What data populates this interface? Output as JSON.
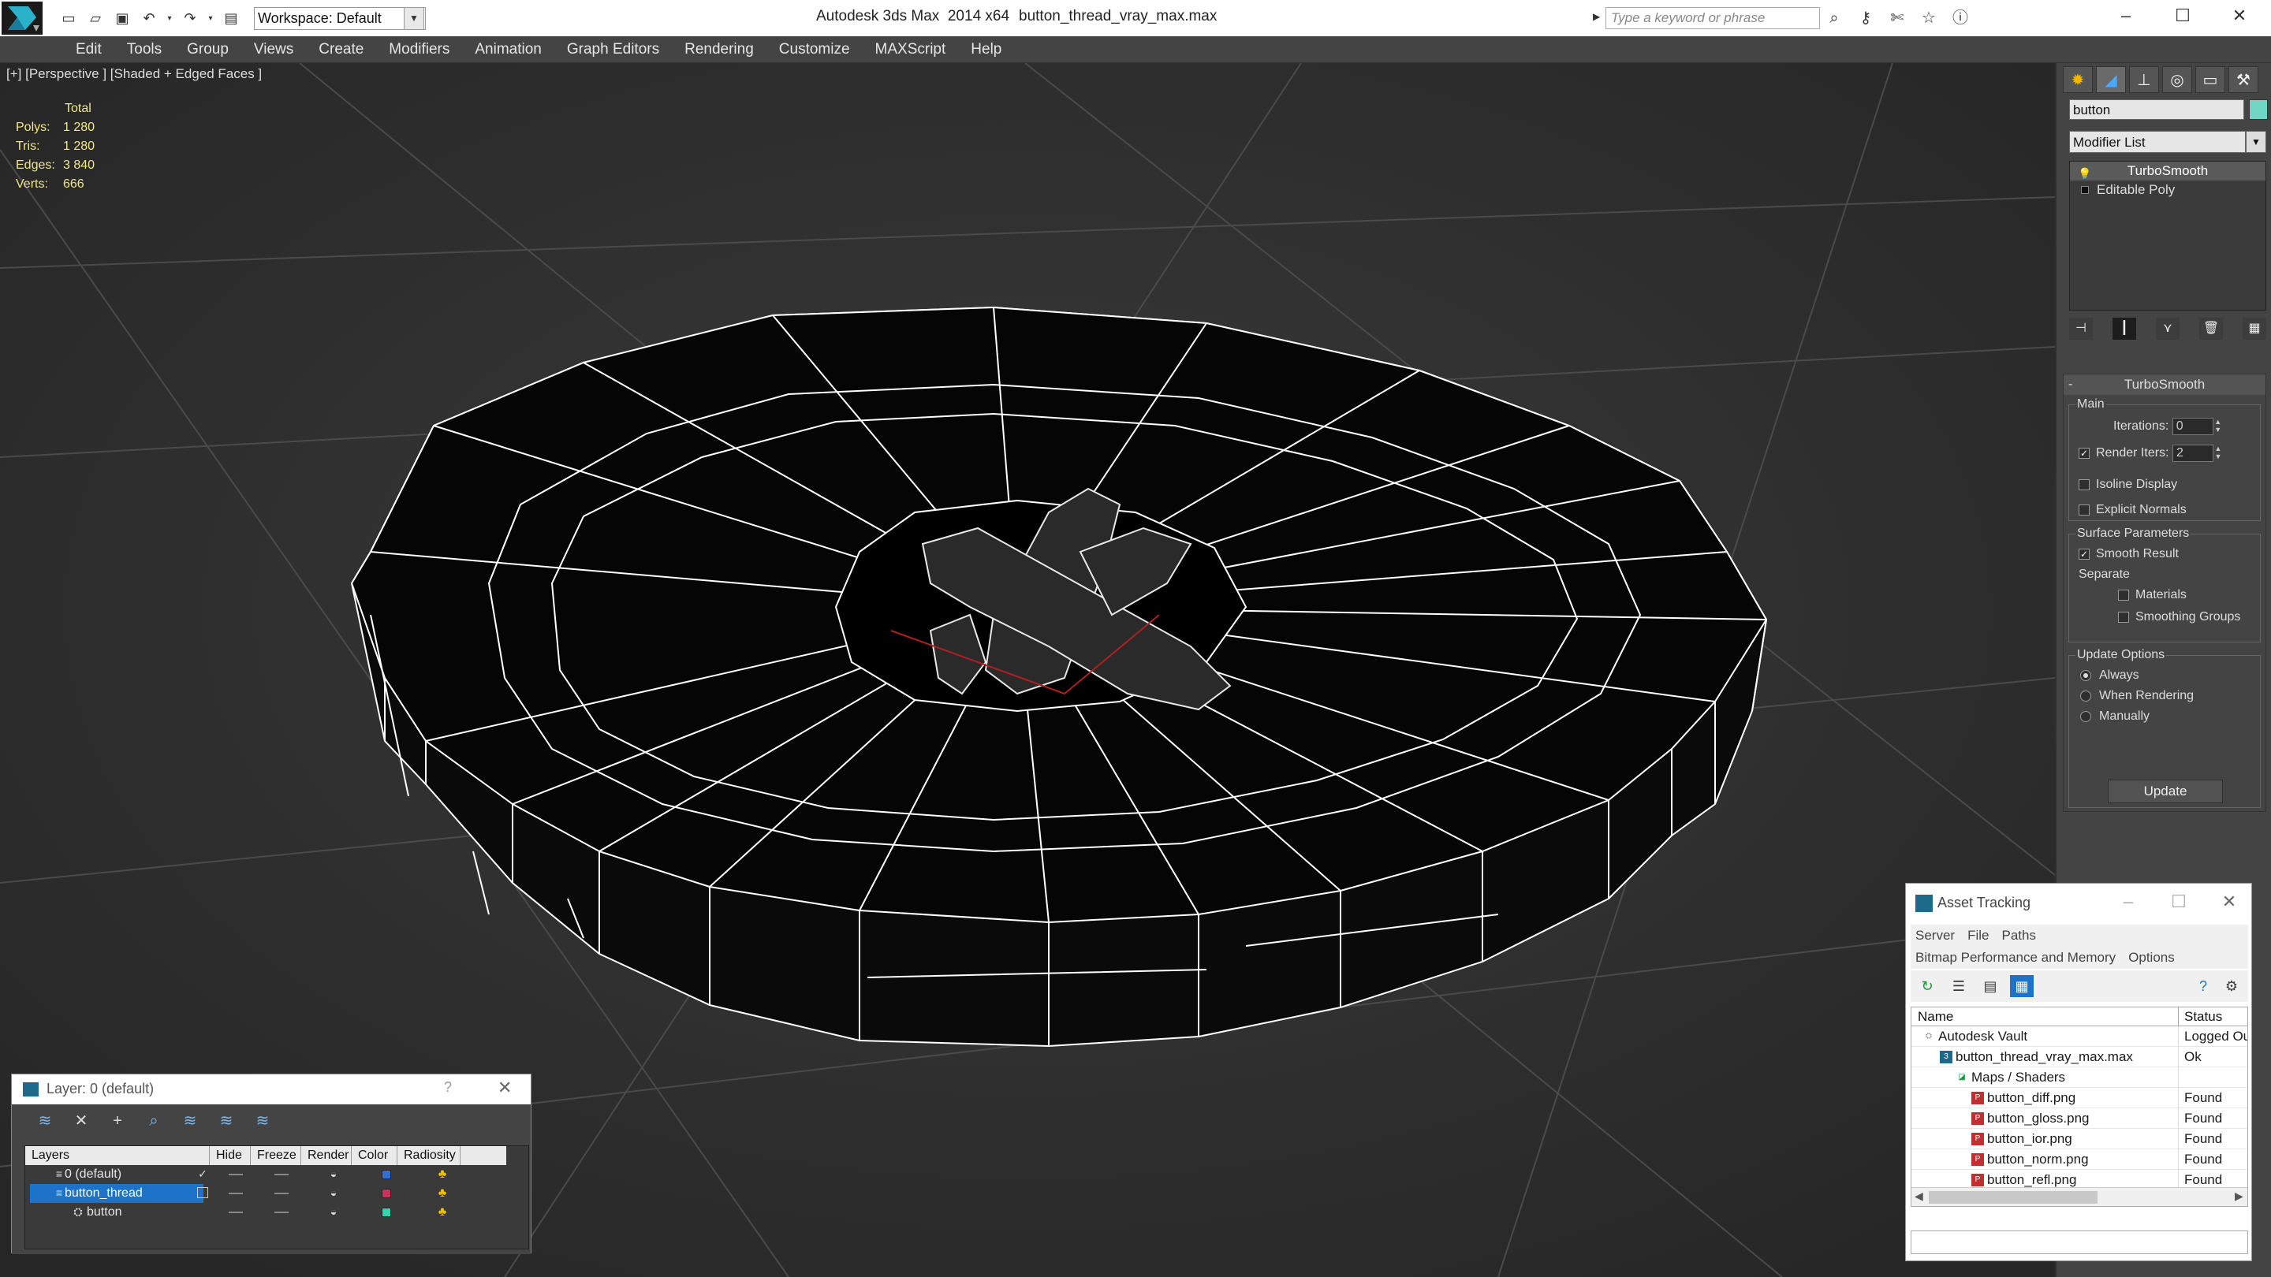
{
  "titlebar": {
    "app_title": "Autodesk 3ds Max  2014 x64",
    "file_name": "button_thread_vray_max.max",
    "workspace": "Workspace: Default",
    "search_placeholder": "Type a keyword or phrase"
  },
  "menu": [
    "Edit",
    "Tools",
    "Group",
    "Views",
    "Create",
    "Modifiers",
    "Animation",
    "Graph Editors",
    "Rendering",
    "Customize",
    "MAXScript",
    "Help"
  ],
  "viewport": {
    "label": "[+] [Perspective ] [Shaded + Edged Faces ]",
    "stats": {
      "header": "Total",
      "polys_label": "Polys:",
      "polys": "1 280",
      "tris_label": "Tris:",
      "tris": "1 280",
      "edges_label": "Edges:",
      "edges": "3 840",
      "verts_label": "Verts:",
      "verts": "666"
    }
  },
  "command_panel": {
    "object_name": "button",
    "object_color": "#6fd6c4",
    "modifier_list": "Modifier List",
    "stack": [
      "TurboSmooth",
      "Editable Poly"
    ],
    "rollout_title": "TurboSmooth",
    "main_group": "Main",
    "iterations_label": "Iterations:",
    "iterations": "0",
    "render_iters_label": "Render Iters:",
    "render_iters": "2",
    "isoline": "Isoline Display",
    "explicit_normals": "Explicit Normals",
    "surface_group": "Surface Parameters",
    "smooth_result": "Smooth Result",
    "separate": "Separate",
    "materials": "Materials",
    "smoothing_groups": "Smoothing Groups",
    "update_group": "Update Options",
    "always": "Always",
    "when_rendering": "When Rendering",
    "manually": "Manually",
    "update_button": "Update"
  },
  "layer_manager": {
    "title": "Layer: 0 (default)",
    "help": "?",
    "columns": [
      "Layers",
      "Hide",
      "Freeze",
      "Render",
      "Color",
      "Radiosity"
    ],
    "rows": [
      {
        "name": "0 (default)",
        "color": "#2f6fd6"
      },
      {
        "name": "button_thread",
        "color": "#d0305a"
      },
      {
        "name": "button",
        "color": "#2fd6b0"
      }
    ]
  },
  "asset_tracking": {
    "title": "Asset Tracking",
    "menu1": [
      "Server",
      "File",
      "Paths"
    ],
    "menu2": [
      "Bitmap Performance and Memory",
      "Options"
    ],
    "col_name": "Name",
    "col_status": "Status",
    "rows": [
      {
        "name": "Autodesk Vault",
        "status": "Logged Out"
      },
      {
        "name": "button_thread_vray_max.max",
        "status": "Ok"
      },
      {
        "name": "Maps / Shaders",
        "status": ""
      },
      {
        "name": "button_diff.png",
        "status": "Found"
      },
      {
        "name": "button_gloss.png",
        "status": "Found"
      },
      {
        "name": "button_ior.png",
        "status": "Found"
      },
      {
        "name": "button_norm.png",
        "status": "Found"
      },
      {
        "name": "button_refl.png",
        "status": "Found"
      }
    ]
  }
}
